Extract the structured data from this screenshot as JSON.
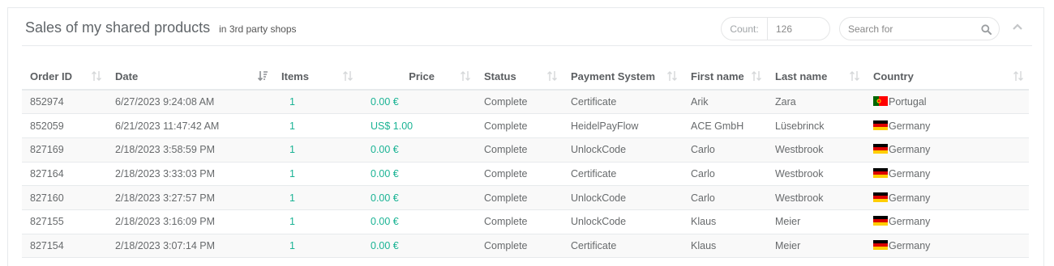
{
  "header": {
    "title": "Sales of my shared products",
    "subtitle": "in 3rd party shops",
    "count_label": "Count:",
    "count_value": "126",
    "search_placeholder": "Search for"
  },
  "table": {
    "columns": [
      "Order ID",
      "Date",
      "Items",
      "Price",
      "Status",
      "Payment System",
      "First name",
      "Last name",
      "Country"
    ],
    "rows": [
      {
        "order_id": "852974",
        "date": "6/27/2023 9:24:08 AM",
        "items": "1",
        "price": "0.00 €",
        "status": "Complete",
        "payment": "Certificate",
        "first": "Arik",
        "last": "Zara",
        "country": "Portugal",
        "flag": "portugal"
      },
      {
        "order_id": "852059",
        "date": "6/21/2023 11:47:42 AM",
        "items": "1",
        "price": "US$ 1.00",
        "status": "Complete",
        "payment": "HeidelPayFlow",
        "first": "ACE GmbH",
        "last": "Lüsebrinck",
        "country": "Germany",
        "flag": "germany"
      },
      {
        "order_id": "827169",
        "date": "2/18/2023 3:58:59 PM",
        "items": "1",
        "price": "0.00 €",
        "status": "Complete",
        "payment": "UnlockCode",
        "first": "Carlo",
        "last": "Westbrook",
        "country": "Germany",
        "flag": "germany"
      },
      {
        "order_id": "827164",
        "date": "2/18/2023 3:33:03 PM",
        "items": "1",
        "price": "0.00 €",
        "status": "Complete",
        "payment": "Certificate",
        "first": "Carlo",
        "last": "Westbrook",
        "country": "Germany",
        "flag": "germany"
      },
      {
        "order_id": "827160",
        "date": "2/18/2023 3:27:57 PM",
        "items": "1",
        "price": "0.00 €",
        "status": "Complete",
        "payment": "UnlockCode",
        "first": "Carlo",
        "last": "Westbrook",
        "country": "Germany",
        "flag": "germany"
      },
      {
        "order_id": "827155",
        "date": "2/18/2023 3:16:09 PM",
        "items": "1",
        "price": "0.00 €",
        "status": "Complete",
        "payment": "UnlockCode",
        "first": "Klaus",
        "last": "Meier",
        "country": "Germany",
        "flag": "germany"
      },
      {
        "order_id": "827154",
        "date": "2/18/2023 3:07:14 PM",
        "items": "1",
        "price": "0.00 €",
        "status": "Complete",
        "payment": "Certificate",
        "first": "Klaus",
        "last": "Meier",
        "country": "Germany",
        "flag": "germany"
      }
    ]
  },
  "icons": {
    "search": "search-icon",
    "collapse": "chevron-up-icon",
    "sort": "sort-icon",
    "sort_active": "sort-desc-icon"
  },
  "colors": {
    "accent": "#1ab394",
    "border": "#e7eaec",
    "text": "#676a6c"
  }
}
